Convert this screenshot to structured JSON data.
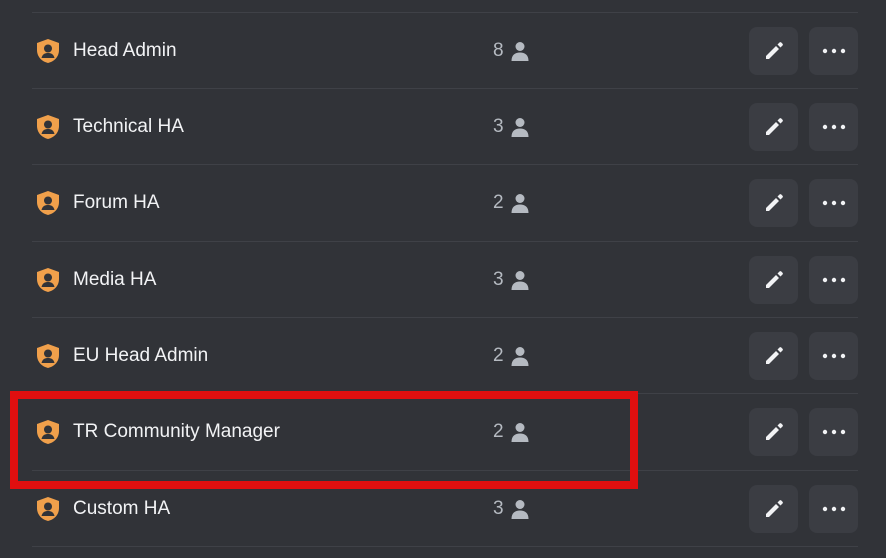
{
  "roles": [
    {
      "name": "Head Admin",
      "count": "8"
    },
    {
      "name": "Technical HA",
      "count": "3"
    },
    {
      "name": "Forum HA",
      "count": "2"
    },
    {
      "name": "Media HA",
      "count": "3"
    },
    {
      "name": "EU Head Admin",
      "count": "2"
    },
    {
      "name": "TR Community Manager",
      "count": "2"
    },
    {
      "name": "Custom HA",
      "count": "3"
    }
  ],
  "icons": {
    "role": "shield-user-icon",
    "members": "person-icon",
    "edit": "pencil-icon",
    "more": "ellipsis-icon"
  },
  "colors": {
    "background": "#313338",
    "role_icon": "#f0a04b",
    "highlight": "#e00f0f"
  }
}
